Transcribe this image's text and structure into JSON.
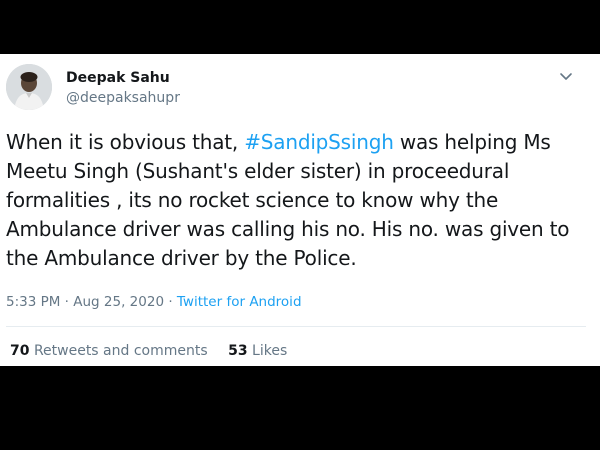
{
  "tweet": {
    "author": {
      "name": "Deepak Sahu",
      "handle": "@deepaksahupr",
      "avatar_icon": "user-avatar-photo"
    },
    "menu_icon": "chevron-down-icon",
    "text_segments": [
      {
        "type": "text",
        "value": "When it is obvious that, "
      },
      {
        "type": "hashtag",
        "value": "#SandipSsingh"
      },
      {
        "type": "text",
        "value": " was helping Ms Meetu Singh (Sushant's elder sister) in proceedural formalities , its no rocket science to know why the Ambulance driver was calling his no. His no. was given to the Ambulance driver by the Police."
      }
    ],
    "timestamp": "5:33 PM · Aug 25, 2020",
    "separator": " · ",
    "source": "Twitter for Android",
    "stats": {
      "retweets_count": "70",
      "retweets_label": "Retweets and comments",
      "likes_count": "53",
      "likes_label": "Likes"
    }
  },
  "colors": {
    "link": "#1da1f2",
    "text": "#14171a",
    "muted": "#657786",
    "background": "#000000",
    "card": "#ffffff"
  }
}
